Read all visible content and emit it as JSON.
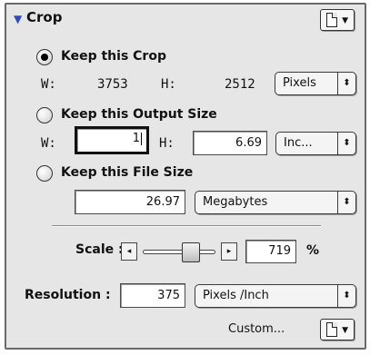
{
  "header": {
    "title": "Crop"
  },
  "keep_crop": {
    "label": "Keep this Crop",
    "w_label": "W:",
    "w_value": "3753",
    "h_label": "H:",
    "h_value": "2512",
    "units": "Pixels"
  },
  "keep_output": {
    "label": "Keep this Output Size",
    "w_label": "W:",
    "w_value": "1",
    "h_label": "H:",
    "h_value": "6.69",
    "units": "Inc..."
  },
  "keep_file": {
    "label": "Keep this File Size",
    "size_value": "26.97",
    "units": "Megabytes"
  },
  "scale": {
    "label": "Scale :",
    "value": "719",
    "unit": "%"
  },
  "resolution": {
    "label": "Resolution :",
    "value": "375",
    "units": "Pixels /Inch"
  },
  "custom": {
    "label": "Custom..."
  }
}
